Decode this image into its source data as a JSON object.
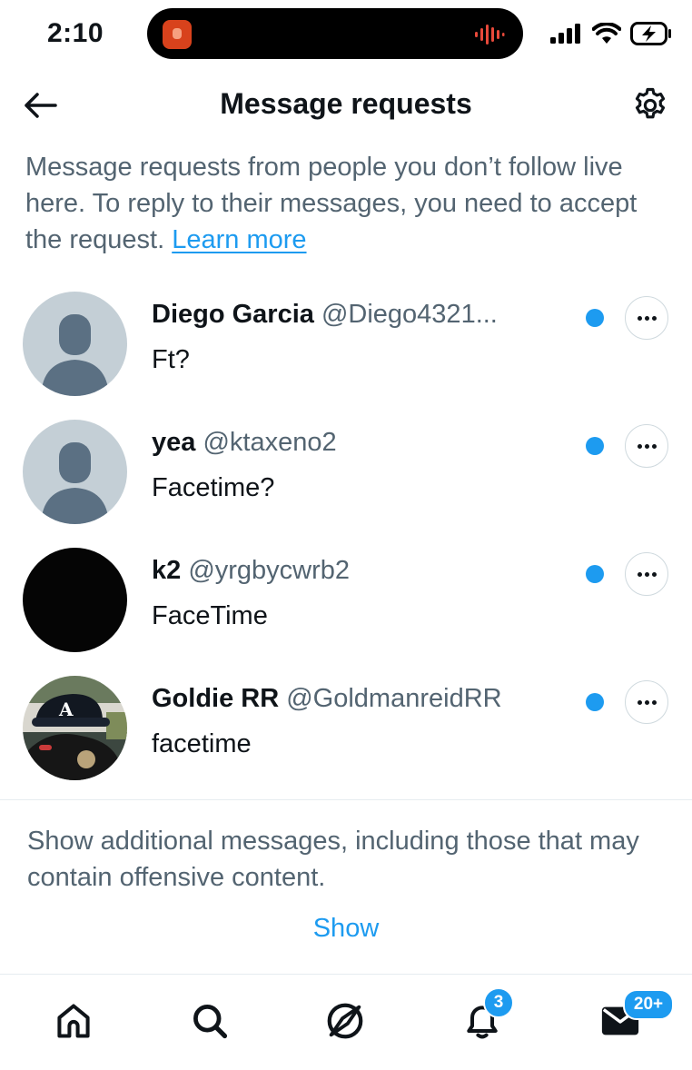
{
  "status_bar": {
    "time": "2:10"
  },
  "header": {
    "title": "Message requests"
  },
  "intro": {
    "text": "Message requests from people you don’t follow live here. To reply to their messages, you need to accept the request.",
    "link_label": "Learn more"
  },
  "requests": [
    {
      "name": "Diego Garcia",
      "handle": "@Diego4321...",
      "message": "Ft?",
      "avatar": "default-avatar",
      "unread": true
    },
    {
      "name": "yea",
      "handle": "@ktaxeno2",
      "message": "Facetime?",
      "avatar": "default-avatar",
      "unread": true
    },
    {
      "name": "k2",
      "handle": "@yrgbycwrb2",
      "message": "FaceTime",
      "avatar": "black-avatar",
      "unread": true
    },
    {
      "name": "Goldie RR",
      "handle": "@GoldmanreidRR",
      "message": "facetime",
      "avatar": "photo-avatar",
      "unread": true
    }
  ],
  "additional": {
    "text": "Show additional messages, including those that may contain offensive content.",
    "show_label": "Show"
  },
  "bottom_nav": {
    "items": [
      {
        "icon": "home-icon"
      },
      {
        "icon": "search-icon"
      },
      {
        "icon": "explore-icon"
      },
      {
        "icon": "bell-icon",
        "badge": "3"
      },
      {
        "icon": "mail-icon",
        "badge": "20+"
      }
    ]
  },
  "colors": {
    "accent": "#1d9bf0",
    "text": "#0f1419",
    "secondary": "#536471"
  }
}
